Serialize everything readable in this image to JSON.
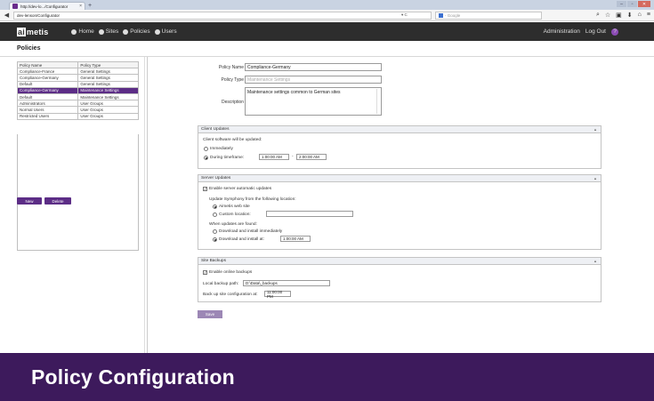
{
  "browser": {
    "tab_title": "http://dev-lo.../Configurator",
    "tab_close": "×",
    "new_tab": "+",
    "win_min": "–",
    "win_max": "▫",
    "win_close": "✕",
    "back_icon": "◀",
    "forward_icon": "▶",
    "url": "dev-lenson/Configurator",
    "reload": "▾ C",
    "search_placeholder": "- Google",
    "toolbar_icons": [
      "⌕",
      "☆",
      "▣",
      "⬇",
      "⌂",
      "≡"
    ]
  },
  "app": {
    "logo_letter": "ai",
    "logo_rest": "metis",
    "nav": [
      {
        "label": "Home"
      },
      {
        "label": "Sites"
      },
      {
        "label": "Policies"
      },
      {
        "label": "Users"
      }
    ],
    "right_links": {
      "administration": "Administration",
      "logout": "Log Out",
      "help": "?"
    }
  },
  "page": {
    "title": "Policies"
  },
  "policies_table": {
    "headers": [
      "Policy Name",
      "Policy Type"
    ],
    "rows": [
      [
        "Compliance-France",
        "General Settings"
      ],
      [
        "Compliance-Germany",
        "General Settings"
      ],
      [
        "Default",
        "General Settings"
      ],
      [
        "Compliance-Germany",
        "Maintenance Settings"
      ],
      [
        "Default",
        "Maintenance Settings"
      ],
      [
        "Administrators",
        "User Groups"
      ],
      [
        "Normal Users",
        "User Groups"
      ],
      [
        "Restricted Users",
        "User Groups"
      ]
    ],
    "selected_index": 3,
    "new_label": "New",
    "delete_label": "Delete"
  },
  "form": {
    "policy_name_label": "Policy Name",
    "policy_name_value": "Compliance-Germany",
    "policy_type_label": "Policy Type",
    "policy_type_value": "Maintenance Settings",
    "description_label": "Description",
    "description_value": "Maintenance settings common to German sites"
  },
  "client_updates": {
    "title": "Client Updates",
    "caret": "▲",
    "intro": "Client software will be updated:",
    "immediately": "Immediately",
    "timeframe": "During timeframe:",
    "time_from": "1:00:00 AM",
    "dash": "-",
    "time_to": "2:00:00 AM"
  },
  "server_updates": {
    "title": "Server Updates",
    "caret": "▲",
    "enable": "Enable server automatic updates",
    "from_location": "Update Symphony from the following location:",
    "aimetis_site": "Aimetis web site",
    "custom_location": "Custom location:",
    "custom_value": "",
    "when_found": "When updates are found:",
    "install_immediately": "Download and install immediately",
    "install_at": "Download and install at:",
    "install_time": "1:00:00 AM"
  },
  "site_backups": {
    "title": "Site Backups",
    "caret": "▲",
    "enable": "Enable online backups",
    "path_label": "Local backup path:",
    "path_value": "D:\\Data\\_backups",
    "backup_at_label": "Back up site configuration at:",
    "backup_at_value": "11:00:00 PM"
  },
  "save_label": "Save",
  "banner": "Policy Configuration",
  "colors": {
    "accent": "#5c2d86",
    "banner": "#3d1a5c",
    "appnav": "#2d2d2d"
  }
}
